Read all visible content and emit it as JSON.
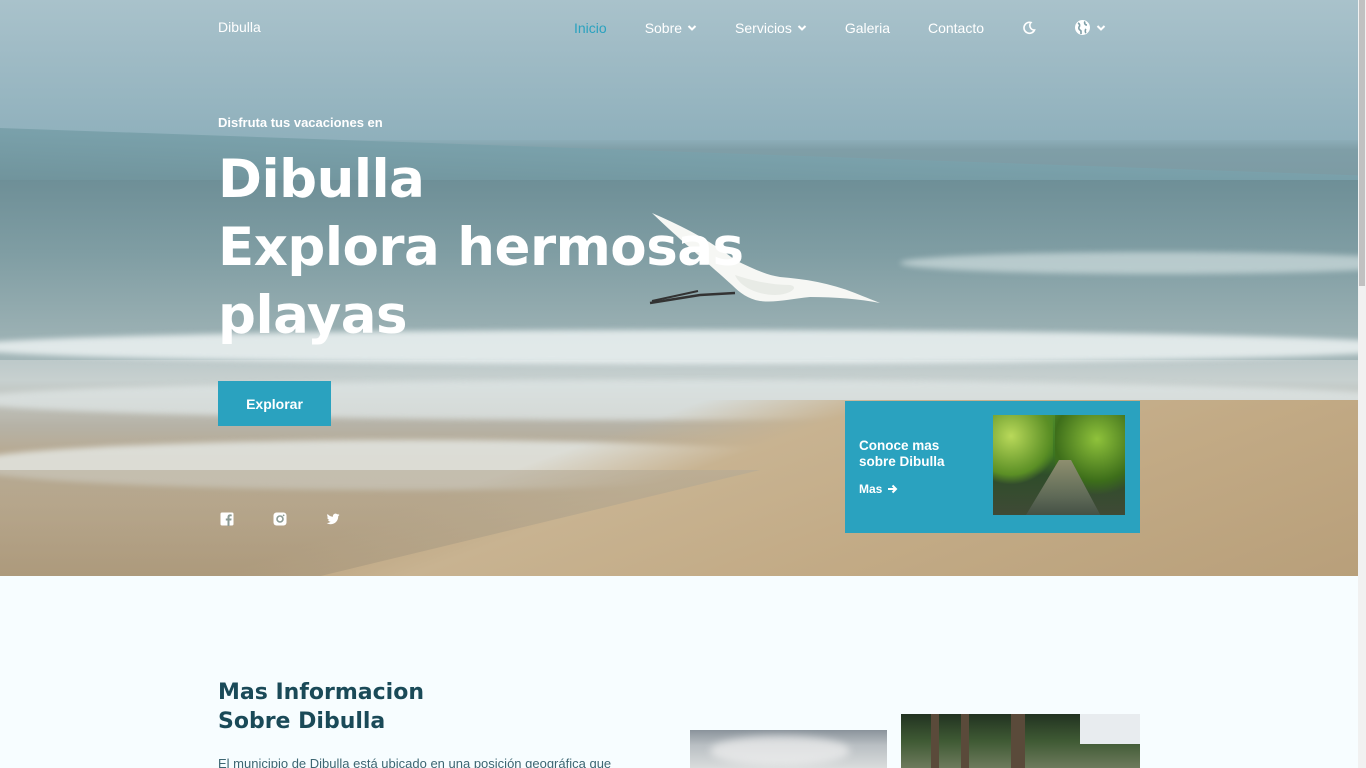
{
  "nav": {
    "brand": "Dibulla",
    "items": [
      {
        "label": "Inicio",
        "active": true,
        "dropdown": false
      },
      {
        "label": "Sobre",
        "active": false,
        "dropdown": true
      },
      {
        "label": "Servicios",
        "active": false,
        "dropdown": true
      },
      {
        "label": "Galeria",
        "active": false,
        "dropdown": false
      },
      {
        "label": "Contacto",
        "active": false,
        "dropdown": false
      }
    ],
    "theme_toggle_icon": "moon-icon",
    "language_icon": "globe-icon"
  },
  "hero": {
    "subtitle": "Disfruta tus vacaciones en",
    "headline_lines": [
      "Dibulla",
      "Explora hermosas",
      "playas"
    ],
    "cta_label": "Explorar",
    "social_icons": [
      "facebook-icon",
      "instagram-icon",
      "twitter-icon"
    ]
  },
  "card": {
    "title": "Conoce mas sobre Dibulla",
    "link_label": "Mas"
  },
  "info": {
    "title_lines": [
      "Mas Informacion",
      "Sobre Dibulla"
    ],
    "body": "El municipio de Dibulla está ubicado en una posición geográfica que"
  },
  "colors": {
    "accent": "#2aa2bf",
    "heading": "#1a4a58",
    "page_bg": "#f7fdff"
  }
}
